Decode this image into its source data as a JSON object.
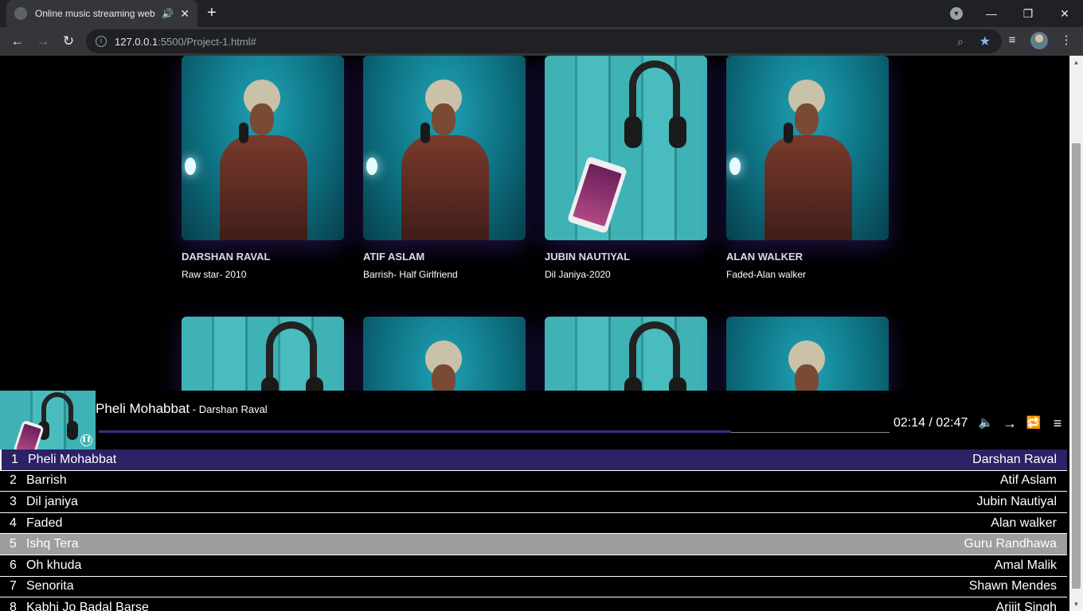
{
  "browser": {
    "tab_title": "Online music streaming web",
    "new_tab": "+",
    "url_host": "127.0.0.1",
    "url_path": ":5500/Project-1.html#",
    "window_controls": {
      "minimize": "—",
      "maximize": "❐",
      "close": "✕"
    }
  },
  "cards": [
    {
      "name": "DARSHAN RAVAL",
      "sub": "Raw star- 2010",
      "art": "singer"
    },
    {
      "name": "ATIF ASLAM",
      "sub": "Barrish- Half Girlfriend",
      "art": "singer"
    },
    {
      "name": "JUBIN NAUTIYAL",
      "sub": "Dil Janiya-2020",
      "art": "headphones"
    },
    {
      "name": "ALAN WALKER",
      "sub": "Faded-Alan walker",
      "art": "singer"
    }
  ],
  "cards_row2": [
    "headphones",
    "singer",
    "headphones",
    "singer"
  ],
  "player": {
    "title": "Pheli Mohabbat",
    "separator": " - ",
    "artist": "Darshan Raval",
    "time": "02:14 / 02:47",
    "progress": 0.8
  },
  "playlist": [
    {
      "num": "1",
      "song": "Pheli Mohabbat",
      "artist": "Darshan Raval",
      "state": "active"
    },
    {
      "num": "2",
      "song": "Barrish",
      "artist": "Atif Aslam",
      "state": ""
    },
    {
      "num": "3",
      "song": "Dil janiya",
      "artist": "Jubin Nautiyal",
      "state": ""
    },
    {
      "num": "4",
      "song": "Faded",
      "artist": "Alan walker",
      "state": ""
    },
    {
      "num": "5",
      "song": "Ishq Tera",
      "artist": "Guru Randhawa",
      "state": "hover"
    },
    {
      "num": "6",
      "song": "Oh khuda",
      "artist": "Amal Malik",
      "state": ""
    },
    {
      "num": "7",
      "song": "Senorita",
      "artist": "Shawn Mendes",
      "state": ""
    },
    {
      "num": "8",
      "song": "Kabhi Jo Badal Barse",
      "artist": "Arijit Singh",
      "state": ""
    }
  ],
  "colors": {
    "accent": "#2c2165",
    "progress": "#3a2d8a",
    "hover_row": "#9e9e9e"
  }
}
